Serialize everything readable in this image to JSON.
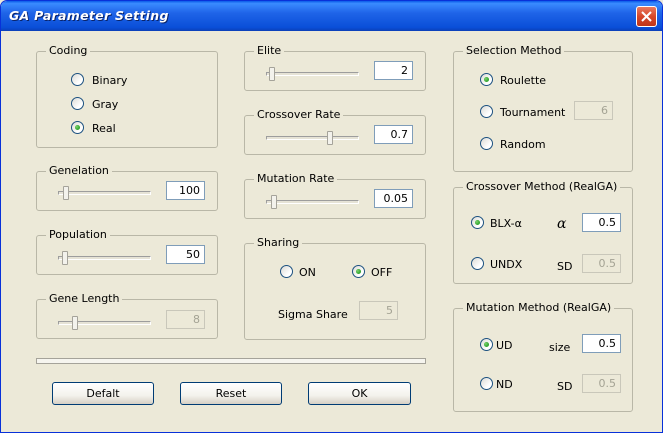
{
  "window": {
    "title": "GA Parameter Setting"
  },
  "coding": {
    "label": "Coding",
    "options": [
      "Binary",
      "Gray",
      "Real"
    ],
    "selected": "Real"
  },
  "genelation": {
    "label": "Genelation",
    "value": "100",
    "slider_fraction": 0.05
  },
  "population": {
    "label": "Population",
    "value": "50",
    "slider_fraction": 0.04
  },
  "gene_length": {
    "label": "Gene Length",
    "value": "8",
    "slider_fraction": 0.15
  },
  "elite": {
    "label": "Elite",
    "value": "2",
    "slider_fraction": 0.02
  },
  "crossover_rate": {
    "label": "Crossover Rate",
    "value": "0.7",
    "slider_fraction": 0.7
  },
  "mutation_rate": {
    "label": "Mutation Rate",
    "value": "0.05",
    "slider_fraction": 0.05
  },
  "sharing": {
    "label": "Sharing",
    "on_label": "ON",
    "off_label": "OFF",
    "selected": "OFF",
    "sigma_label": "Sigma Share",
    "sigma_value": "5"
  },
  "selection": {
    "label": "Selection Method",
    "roulette": "Roulette",
    "tournament": "Tournament",
    "tournament_value": "6",
    "random": "Random",
    "selected": "Roulette"
  },
  "crossover_method": {
    "label": "Crossover Method (RealGA)",
    "blx": "BLX-α",
    "alpha_symbol": "α",
    "alpha_value": "0.5",
    "undx": "UNDX",
    "sd_label": "SD",
    "sd_value": "0.5",
    "selected": "BLX-α"
  },
  "mutation_method": {
    "label": "Mutation Method (RealGA)",
    "ud": "UD",
    "size_label": "size",
    "size_value": "0.5",
    "nd": "ND",
    "sd_label": "SD",
    "sd_value": "0.5",
    "selected": "UD"
  },
  "buttons": {
    "default": "Defalt",
    "reset": "Reset",
    "ok": "OK"
  }
}
